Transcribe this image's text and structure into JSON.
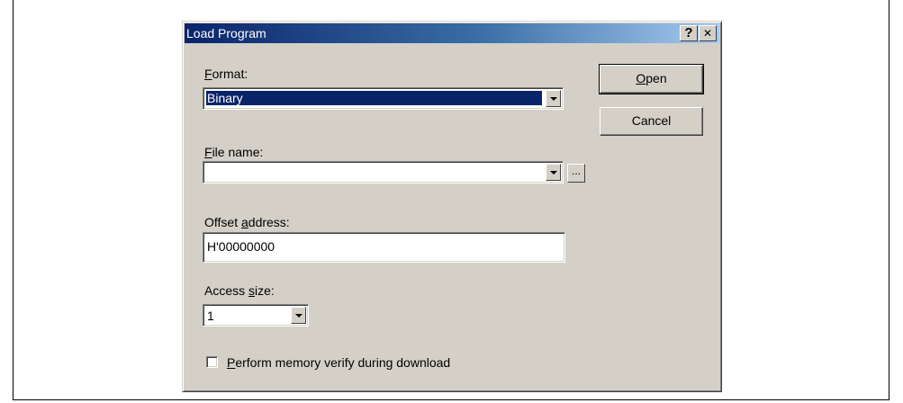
{
  "dialog": {
    "title": "Load Program",
    "help_button": "?",
    "close_button": "✕"
  },
  "format": {
    "label_hotkey": "F",
    "label_rest": "ormat:",
    "value": "Binary"
  },
  "file_name": {
    "label_hotkey": "F",
    "label_rest": "ile name:",
    "value": "",
    "browse_label": "..."
  },
  "offset_address": {
    "label_pre": "Offset ",
    "label_hotkey": "a",
    "label_rest": "ddress:",
    "value": "H'00000000"
  },
  "access_size": {
    "label_pre": "Access ",
    "label_hotkey": "s",
    "label_rest": "ize:",
    "value": "1"
  },
  "verify": {
    "label_hotkey": "P",
    "label_rest": "erform memory verify during download",
    "checked": false
  },
  "buttons": {
    "open_hotkey": "O",
    "open_rest": "pen",
    "cancel": "Cancel"
  }
}
